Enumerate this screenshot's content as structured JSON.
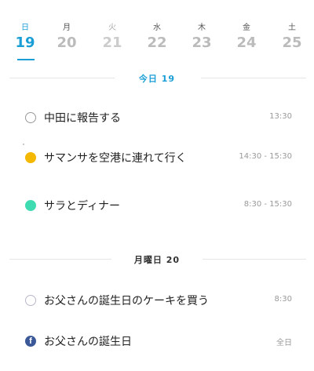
{
  "week": [
    {
      "dow": "日",
      "date": "19",
      "selected": true
    },
    {
      "dow": "月",
      "date": "20"
    },
    {
      "dow": "火",
      "date": "21"
    },
    {
      "dow": "水",
      "date": "22"
    },
    {
      "dow": "木",
      "date": "23"
    },
    {
      "dow": "金",
      "date": "24"
    },
    {
      "dow": "土",
      "date": "25"
    }
  ],
  "sections": [
    {
      "label": "今日 19",
      "color": "#1a9ed6",
      "events": [
        {
          "icon": "empty-circle-icon",
          "title": "中田に報告する",
          "time": "13:30"
        },
        {
          "icon": "yellow-circle-icon",
          "color": "#f5b800",
          "title": "サマンサを空港に連れて行く",
          "time": "14:30 - 15:30"
        },
        {
          "icon": "teal-circle-icon",
          "color": "#3fdbb1",
          "title": "サラとディナー",
          "time": "8:30 - 15:30"
        }
      ]
    },
    {
      "label": "月曜日 20",
      "color": "#333333",
      "events": [
        {
          "icon": "empty-circle-icon",
          "title": "お父さんの誕生日のケーキを買う",
          "time": "8:30"
        },
        {
          "icon": "facebook-icon",
          "color": "#3b5998",
          "title": "お父さんの誕生日",
          "time": "全日"
        }
      ]
    }
  ]
}
